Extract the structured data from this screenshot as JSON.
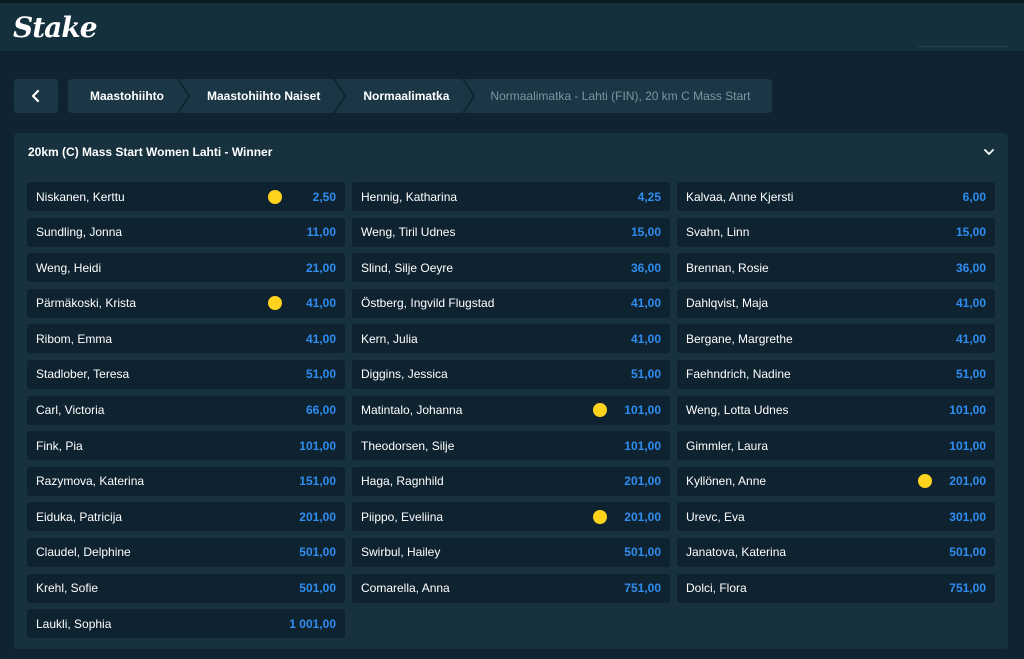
{
  "app": {
    "logo": "Stake"
  },
  "breadcrumb": {
    "items": [
      {
        "label": "Maastohiihto",
        "current": false
      },
      {
        "label": "Maastohiihto Naiset",
        "current": false
      },
      {
        "label": "Normaalimatka",
        "current": false
      },
      {
        "label": "Normaalimatka - Lahti (FIN), 20 km C Mass Start",
        "current": true
      }
    ]
  },
  "market": {
    "title": "20km (C) Mass Start Women Lahti - Winner",
    "rows": [
      [
        {
          "name": "Niskanen, Kerttu",
          "odds": "2,50",
          "boost": true
        },
        {
          "name": "Hennig, Katharina",
          "odds": "4,25",
          "boost": false
        },
        {
          "name": "Kalvaa, Anne Kjersti",
          "odds": "6,00",
          "boost": false
        }
      ],
      [
        {
          "name": "Sundling, Jonna",
          "odds": "11,00",
          "boost": false
        },
        {
          "name": "Weng, Tiril Udnes",
          "odds": "15,00",
          "boost": false
        },
        {
          "name": "Svahn, Linn",
          "odds": "15,00",
          "boost": false
        }
      ],
      [
        {
          "name": "Weng, Heidi",
          "odds": "21,00",
          "boost": false
        },
        {
          "name": "Slind, Silje Oeyre",
          "odds": "36,00",
          "boost": false
        },
        {
          "name": "Brennan, Rosie",
          "odds": "36,00",
          "boost": false
        }
      ],
      [
        {
          "name": "Pärmäkoski, Krista",
          "odds": "41,00",
          "boost": true
        },
        {
          "name": "Östberg, Ingvild Flugstad",
          "odds": "41,00",
          "boost": false
        },
        {
          "name": "Dahlqvist, Maja",
          "odds": "41,00",
          "boost": false
        }
      ],
      [
        {
          "name": "Ribom, Emma",
          "odds": "41,00",
          "boost": false
        },
        {
          "name": "Kern, Julia",
          "odds": "41,00",
          "boost": false
        },
        {
          "name": "Bergane, Margrethe",
          "odds": "41,00",
          "boost": false
        }
      ],
      [
        {
          "name": "Stadlober, Teresa",
          "odds": "51,00",
          "boost": false
        },
        {
          "name": "Diggins, Jessica",
          "odds": "51,00",
          "boost": false
        },
        {
          "name": "Faehndrich, Nadine",
          "odds": "51,00",
          "boost": false
        }
      ],
      [
        {
          "name": "Carl, Victoria",
          "odds": "66,00",
          "boost": false
        },
        {
          "name": "Matintalo, Johanna",
          "odds": "101,00",
          "boost": true
        },
        {
          "name": "Weng, Lotta Udnes",
          "odds": "101,00",
          "boost": false
        }
      ],
      [
        {
          "name": "Fink, Pia",
          "odds": "101,00",
          "boost": false
        },
        {
          "name": "Theodorsen, Silje",
          "odds": "101,00",
          "boost": false
        },
        {
          "name": "Gimmler, Laura",
          "odds": "101,00",
          "boost": false
        }
      ],
      [
        {
          "name": "Razymova, Katerina",
          "odds": "151,00",
          "boost": false
        },
        {
          "name": "Haga, Ragnhild",
          "odds": "201,00",
          "boost": false
        },
        {
          "name": "Kyllönen, Anne",
          "odds": "201,00",
          "boost": true
        }
      ],
      [
        {
          "name": "Eiduka, Patricija",
          "odds": "201,00",
          "boost": false
        },
        {
          "name": "Piippo, Eveliina",
          "odds": "201,00",
          "boost": true
        },
        {
          "name": "Urevc, Eva",
          "odds": "301,00",
          "boost": false
        }
      ],
      [
        {
          "name": "Claudel, Delphine",
          "odds": "501,00",
          "boost": false
        },
        {
          "name": "Swirbul, Hailey",
          "odds": "501,00",
          "boost": false
        },
        {
          "name": "Janatova, Katerina",
          "odds": "501,00",
          "boost": false
        }
      ],
      [
        {
          "name": "Krehl, Sofie",
          "odds": "501,00",
          "boost": false
        },
        {
          "name": "Comarella, Anna",
          "odds": "751,00",
          "boost": false
        },
        {
          "name": "Dolci, Flora",
          "odds": "751,00",
          "boost": false
        }
      ],
      [
        {
          "name": "Laukli, Sophia",
          "odds": "1 001,00",
          "boost": false
        }
      ]
    ]
  },
  "colors": {
    "odds": "#2f8df0",
    "boost": "#ffd21e",
    "background": "#0f2430",
    "panel": "#17313e",
    "cell": "#0f2230"
  },
  "icons": {
    "back": "chevron-left-icon",
    "collapse": "chevron-down-icon",
    "boost": "boost-dot-icon"
  }
}
